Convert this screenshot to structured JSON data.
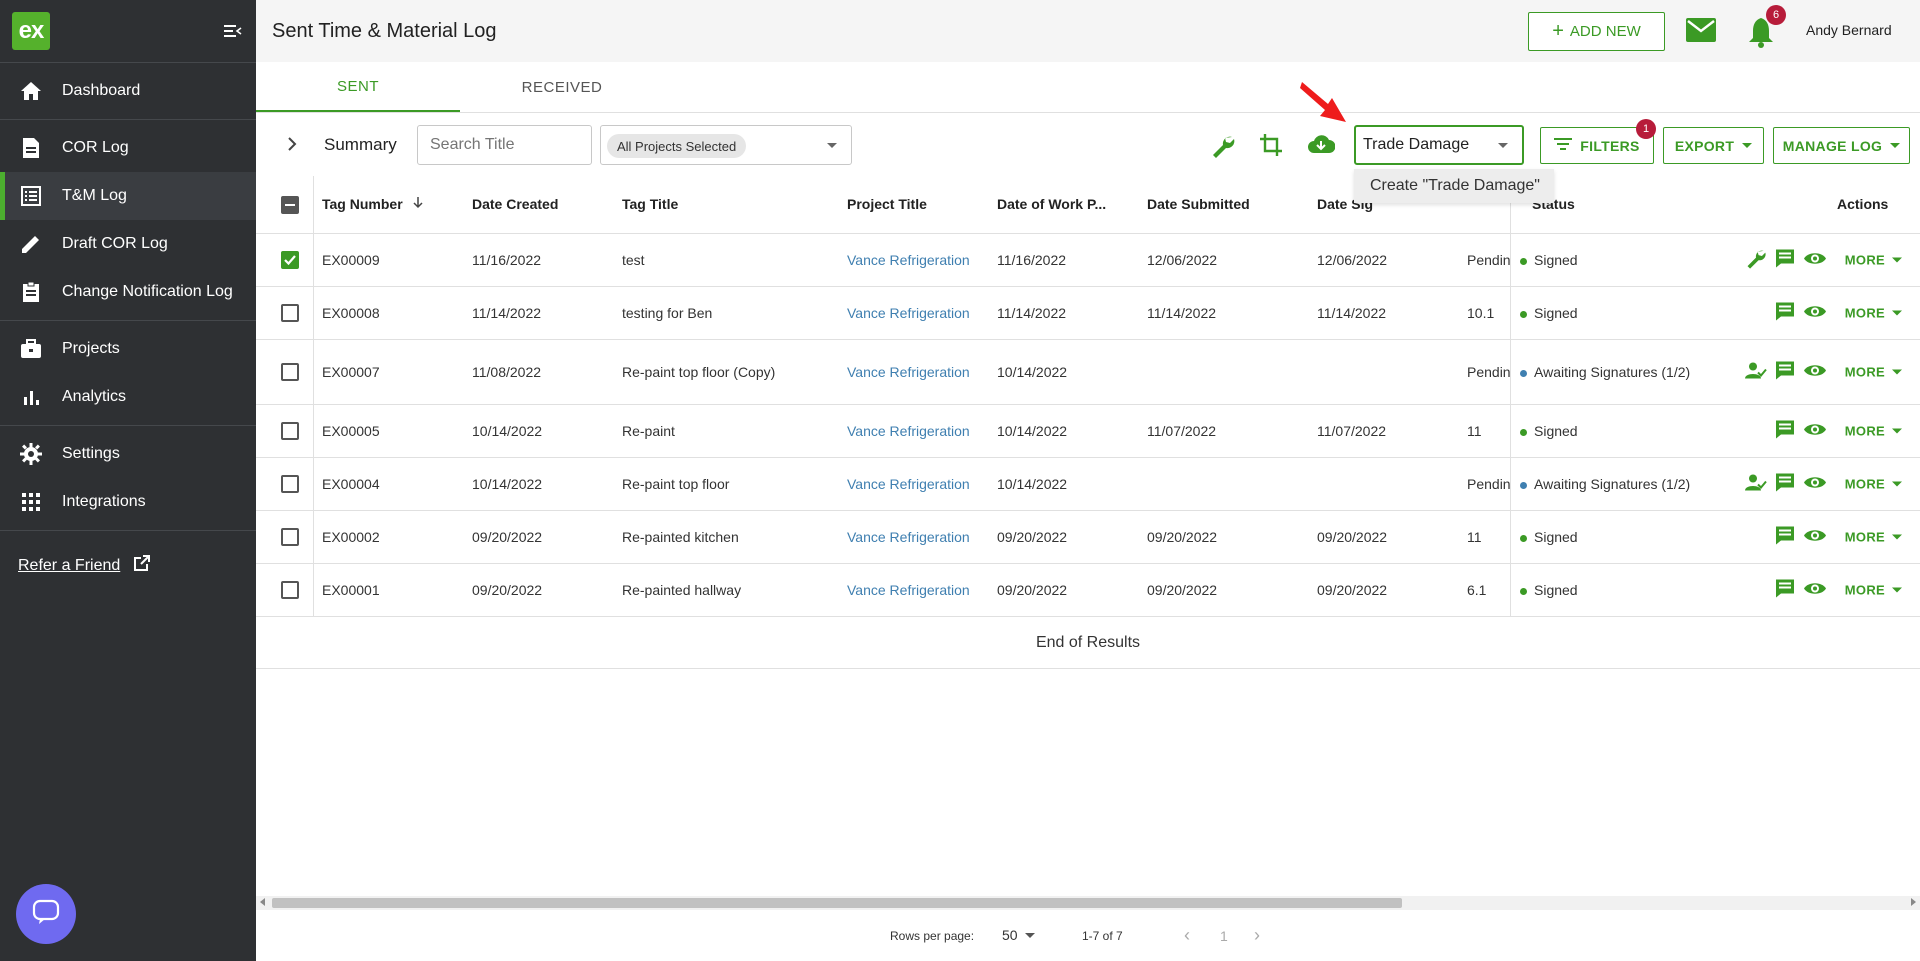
{
  "app": {
    "logo_text": "ex",
    "title": "Sent Time & Material Log"
  },
  "sidebar": {
    "groups": [
      [
        {
          "label": "Dashboard",
          "icon": "home-icon"
        }
      ],
      [
        {
          "label": "COR Log",
          "icon": "document-icon"
        },
        {
          "label": "T&M Log",
          "icon": "list-icon",
          "active": true
        },
        {
          "label": "Draft COR Log",
          "icon": "pencil-icon"
        },
        {
          "label": "Change Notification Log",
          "icon": "clipboard-icon"
        }
      ],
      [
        {
          "label": "Projects",
          "icon": "briefcase-icon"
        },
        {
          "label": "Analytics",
          "icon": "bar-chart-icon"
        }
      ],
      [
        {
          "label": "Settings",
          "icon": "gear-icon"
        },
        {
          "label": "Integrations",
          "icon": "grid-icon"
        }
      ]
    ],
    "refer": "Refer a Friend"
  },
  "header": {
    "add_new": "ADD NEW",
    "notifications": "6",
    "user": "Andy Bernard"
  },
  "tabs": [
    {
      "label": "SENT",
      "active": true
    },
    {
      "label": "RECEIVED",
      "active": false
    }
  ],
  "toolbar": {
    "summary": "Summary",
    "search_placeholder": "Search Title",
    "projects_chip": "All Projects Selected",
    "tag_input": "Trade Damage",
    "suggestion": "Create \"Trade Damage\"",
    "filters": "FILTERS",
    "filters_badge": "1",
    "export": "EXPORT",
    "manage_log": "MANAGE LOG"
  },
  "table": {
    "headers": {
      "tag_number": "Tag Number",
      "date_created": "Date Created",
      "tag_title": "Tag Title",
      "project_title": "Project Title",
      "date_work": "Date of Work P...",
      "date_submitted": "Date Submitted",
      "date_signed": "Date Sig",
      "status": "Status",
      "actions": "Actions"
    },
    "rows": [
      {
        "tag": "EX00009",
        "created": "11/16/2022",
        "title": "test",
        "project": "Vance Refrigeration",
        "work": "11/16/2022",
        "submitted": "12/06/2022",
        "signed": "12/06/2022",
        "extra": "Pendin",
        "status": "Signed",
        "checked": true,
        "wrench": true,
        "person": false
      },
      {
        "tag": "EX00008",
        "created": "11/14/2022",
        "title": "testing for Ben",
        "project": "Vance Refrigeration",
        "work": "11/14/2022",
        "submitted": "11/14/2022",
        "signed": "11/14/2022",
        "extra": "10.1",
        "status": "Signed",
        "checked": false,
        "wrench": false,
        "person": false
      },
      {
        "tag": "EX00007",
        "created": "11/08/2022",
        "title": "Re-paint top floor (Copy)",
        "project": "Vance Refrigeration",
        "work": "10/14/2022",
        "submitted": "",
        "signed": "",
        "extra": "Pendin",
        "status": "Awaiting Signatures (1/2)",
        "checked": false,
        "wrench": false,
        "person": true
      },
      {
        "tag": "EX00005",
        "created": "10/14/2022",
        "title": "Re-paint",
        "project": "Vance Refrigeration",
        "work": "10/14/2022",
        "submitted": "11/07/2022",
        "signed": "11/07/2022",
        "extra": "11",
        "status": "Signed",
        "checked": false,
        "wrench": false,
        "person": false
      },
      {
        "tag": "EX00004",
        "created": "10/14/2022",
        "title": "Re-paint top floor",
        "project": "Vance Refrigeration",
        "work": "10/14/2022",
        "submitted": "",
        "signed": "",
        "extra": "Pendin",
        "status": "Awaiting Signatures (1/2)",
        "checked": false,
        "wrench": false,
        "person": true
      },
      {
        "tag": "EX00002",
        "created": "09/20/2022",
        "title": "Re-painted kitchen",
        "project": "Vance Refrigeration",
        "work": "09/20/2022",
        "submitted": "09/20/2022",
        "signed": "09/20/2022",
        "extra": "11",
        "status": "Signed",
        "checked": false,
        "wrench": false,
        "person": false
      },
      {
        "tag": "EX00001",
        "created": "09/20/2022",
        "title": "Re-painted hallway",
        "project": "Vance Refrigeration",
        "work": "09/20/2022",
        "submitted": "09/20/2022",
        "signed": "09/20/2022",
        "extra": "6.1",
        "status": "Signed",
        "checked": false,
        "wrench": false,
        "person": false
      }
    ],
    "more_label": "MORE",
    "end_text": "End of Results"
  },
  "footer": {
    "rows_per_page_label": "Rows per page:",
    "rows_per_page": "50",
    "range": "1-7 of 7",
    "page": "1"
  },
  "colors": {
    "green": "#3b9a25",
    "sidebar": "#2e3033",
    "signed_dot": "#3b9a25",
    "awaiting_dot": "#3f7fb0",
    "badge": "#b71c3a"
  }
}
